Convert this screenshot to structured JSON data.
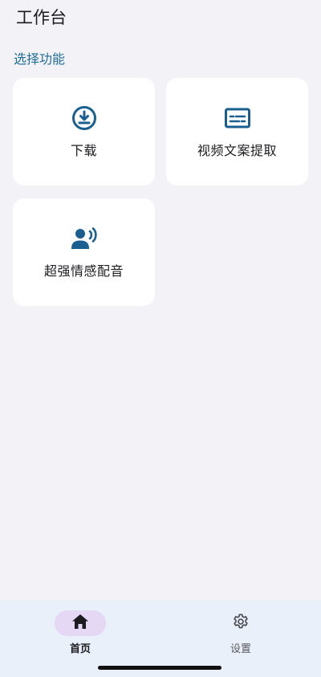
{
  "header": {
    "title": "工作台"
  },
  "section": {
    "label": "选择功能"
  },
  "cards": [
    {
      "label": "下载",
      "icon": "download-circle-icon"
    },
    {
      "label": "视频文案提取",
      "icon": "subtitles-icon"
    },
    {
      "label": "超强情感配音",
      "icon": "voice-speaker-icon"
    }
  ],
  "bottom_nav": {
    "items": [
      {
        "label": "首页",
        "icon": "home-icon",
        "active": true
      },
      {
        "label": "设置",
        "icon": "gear-icon",
        "active": false
      }
    ]
  },
  "colors": {
    "accent": "#1f6e94",
    "icon_blue": "#1a5f8f",
    "background": "#f3f2f7",
    "card": "#ffffff",
    "nav_background": "#eaf0fa",
    "active_pill": "#e4d8f5"
  }
}
